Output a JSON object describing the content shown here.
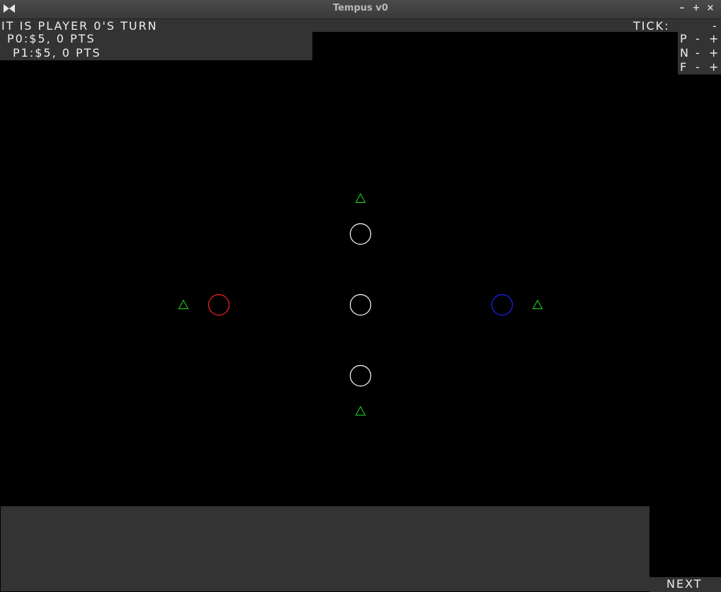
{
  "window": {
    "title": "Tempus v0",
    "minimize_label": "–",
    "maximize_label": "+",
    "close_label": "×"
  },
  "hud": {
    "turn_text": "IT IS PLAYER 0'S TURN",
    "tick_label": "TICK:",
    "tick_value": "-",
    "players": [
      {
        "score_text": "P0:$5, 0 PTS"
      },
      {
        "score_text": "P1:$5, 0 PTS"
      }
    ],
    "speed_controls": [
      {
        "label": "P",
        "minus": "-",
        "plus": "+"
      },
      {
        "label": "N",
        "minus": "-",
        "plus": "+"
      },
      {
        "label": "F",
        "minus": "-",
        "plus": "+"
      }
    ],
    "next_label": "NEXT"
  },
  "board": {
    "colors": {
      "neutral_node": "#ffffff",
      "player0_node": "#ff2020",
      "player1_node": "#2020ff",
      "unit_marker": "#20e020"
    },
    "nodes": [
      {
        "id": "top",
        "owner": "neutral"
      },
      {
        "id": "center",
        "owner": "neutral"
      },
      {
        "id": "bottom",
        "owner": "neutral"
      },
      {
        "id": "left",
        "owner": "player0"
      },
      {
        "id": "right",
        "owner": "player1"
      }
    ],
    "markers": [
      {
        "id": "top",
        "shape": "triangle"
      },
      {
        "id": "bottom",
        "shape": "triangle"
      },
      {
        "id": "left",
        "shape": "triangle"
      },
      {
        "id": "right",
        "shape": "triangle"
      }
    ]
  }
}
